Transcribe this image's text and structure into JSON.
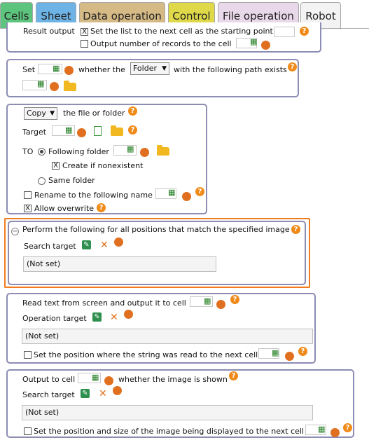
{
  "tabs": [
    {
      "label": "Cells",
      "color": "#5cc47d"
    },
    {
      "label": "Sheet",
      "color": "#6eb3e6"
    },
    {
      "label": "Data operation",
      "color": "#d6ba86"
    },
    {
      "label": "Control",
      "color": "#dfd94a"
    },
    {
      "label": "File operation",
      "color": "#e9d8e9"
    },
    {
      "label": "Robot",
      "color": "#f3f3f3"
    }
  ],
  "panel0": {
    "result_output": "Result output",
    "set_list_next": "Set the list to the next cell as the starting point",
    "output_count": "Output number of records to the cell"
  },
  "panel1": {
    "set": "Set",
    "whether_the": "whether the",
    "folder_select": "Folder",
    "path_exists": "with the following path exists"
  },
  "panel2": {
    "action_select": "Copy",
    "file_or_folder": "the file or folder",
    "target": "Target",
    "to": "TO",
    "following_folder": "Following folder",
    "create_if_nonexistent": "Create if nonexistent",
    "same_folder": "Same folder",
    "rename": "Rename to the following name",
    "allow_overwrite": "Allow overwrite"
  },
  "panel3": {
    "title": "Perform the following for all positions that match the specified image",
    "search_target": "Search target",
    "not_set": "(Not set)"
  },
  "panel4": {
    "title": "Read text from screen and output it to cell",
    "operation_target": "Operation target",
    "not_set": "(Not set)",
    "set_position": "Set the position where the string was read to the next cell"
  },
  "panel5": {
    "output_to_cell": "Output to cell",
    "whether_shown": "whether the image is shown",
    "search_target": "Search target",
    "not_set": "(Not set)",
    "set_position_size": "Set the position and size of the image being displayed to the next cell"
  },
  "icons": {
    "help": "help-icon",
    "cell": "cell-picker-icon",
    "var": "variable-icon"
  },
  "help_glyph": "?",
  "dropdown_glyph": "▼",
  "clear_glyph": "✕",
  "checked_glyph": "X",
  "collapse_glyph": "−"
}
